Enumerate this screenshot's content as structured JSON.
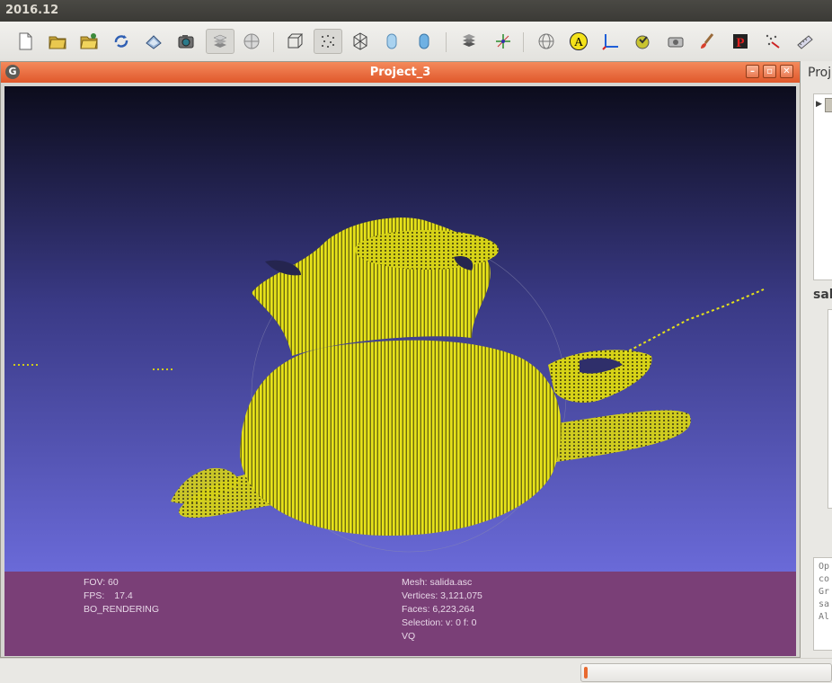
{
  "app": {
    "window_title": "2016.12"
  },
  "toolbar": {
    "icons": [
      "new-file-icon",
      "open-folder-icon",
      "open-project-icon",
      "reload-icon",
      "save-icon",
      "snapshot-icon",
      "layers-icon",
      "sphere-icon",
      "bbox-icon",
      "points-render-icon",
      "wireframe-render-icon",
      "flat-render-icon",
      "smooth-render-icon",
      "texture-icon",
      "axes-move-icon",
      "globe-icon",
      "annotation-a-icon",
      "axis-icon",
      "color-icon",
      "camera-icon",
      "paint-brush-icon",
      "pick-points-icon",
      "align-icon",
      "measure-icon"
    ]
  },
  "subwindow": {
    "title": "Project_3",
    "buttons": [
      "minimize",
      "restore",
      "close"
    ]
  },
  "info": {
    "fov": "FOV: 60",
    "fps_label": "FPS:",
    "fps_value": "17.4",
    "render_mode": "BO_RENDERING",
    "mesh": "Mesh: salida.asc",
    "vertices": "Vertices: 3,121,075",
    "faces": "Faces: 6,223,264",
    "selection": "Selection: v: 0 f: 0",
    "vq": "VQ"
  },
  "right_panel": {
    "header": "Proj",
    "label2": "sal",
    "log_lines": [
      "Op",
      "co",
      "Gr",
      "sa",
      "Al"
    ]
  },
  "colors": {
    "viewport_top": "#0c0c1c",
    "viewport_bottom": "#6a6ad8",
    "point_cloud": "#e6e21a",
    "info_bar": "#7a3f77",
    "accent_orange": "#e8692f"
  }
}
